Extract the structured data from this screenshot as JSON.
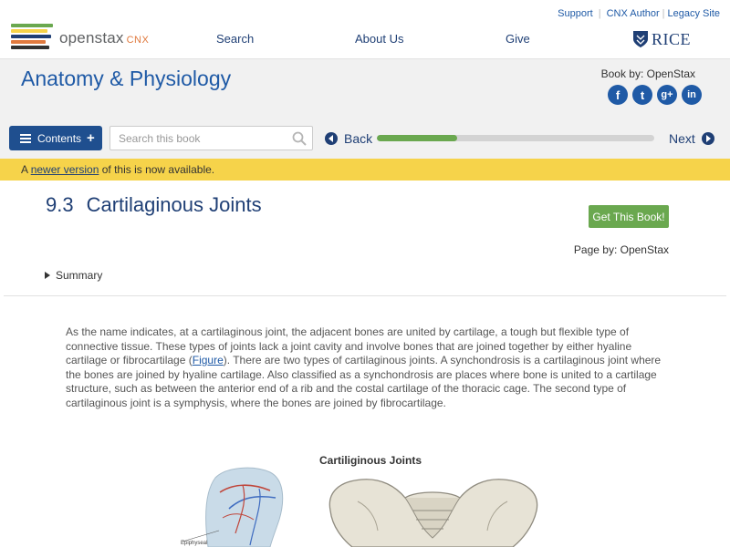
{
  "header": {
    "logo": {
      "main": "openstax",
      "suffix": "CNX"
    },
    "top_links": [
      "Support",
      "CNX Author",
      "Legacy Site"
    ],
    "nav": [
      "Search",
      "About Us",
      "Give"
    ],
    "partner": "RICE"
  },
  "book": {
    "title": "Anatomy & Physiology",
    "by": "Book by: OpenStax",
    "social": [
      "facebook",
      "twitter",
      "google-plus",
      "linkedin"
    ],
    "social_glyphs": [
      "f",
      "t",
      "g+",
      "in"
    ]
  },
  "toolbar": {
    "contents_label": "Contents",
    "search_placeholder": "Search this book",
    "back_label": "Back",
    "next_label": "Next",
    "progress_fraction": 0.29
  },
  "notice": {
    "prefix": "A ",
    "link": "newer version",
    "suffix": " of this is now available."
  },
  "page": {
    "number": "9.3",
    "title": "Cartilaginous Joints",
    "get_book": "Get This Book!",
    "by": "Page by: OpenStax",
    "summary": "Summary",
    "body_1": "As the name indicates, at a cartilaginous joint, the adjacent bones are united by cartilage, a tough but flexible type of connective tissue. These types of joints lack a joint cavity and involve bones that are joined together by either hyaline cartilage or fibrocartilage (",
    "body_link": "Figure",
    "body_2": "). There are two types of cartilaginous joints. A synchondrosis is a cartilaginous joint where the bones are joined by hyaline cartilage. Also classified as a synchondrosis are places where bone is united to a cartilage structure, such as between the anterior end of a rib and the costal cartilage of the thoracic cage. The second type of cartilaginous joint is a symphysis, where the bones are joined by fibrocartilage.",
    "figure_title": "Cartiliginous Joints",
    "figure_label": "Epiphyseal"
  },
  "colors": {
    "brand_blue": "#1f5aa6",
    "navy": "#1f3f75",
    "green": "#6aa84f",
    "notice_yellow": "#f6d34a"
  }
}
